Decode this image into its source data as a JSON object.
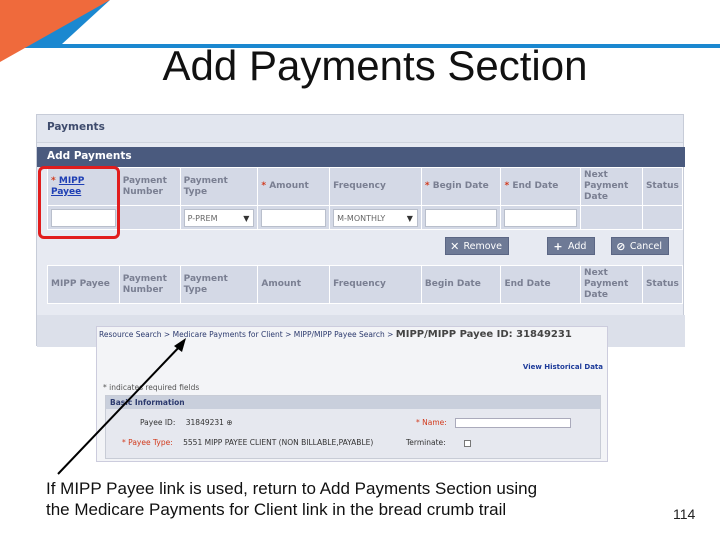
{
  "slide": {
    "title": "Add Payments Section",
    "caption_line1": "If MIPP Payee link is used, return to Add Payments Section  using",
    "caption_line2": "the Medicare Payments for Client link in the bread crumb trail",
    "page_number": "114"
  },
  "panel": {
    "header": "Payments",
    "section_title": "Add Payments",
    "columns": [
      {
        "label": "MIPP Payee",
        "required": true,
        "link": true
      },
      {
        "label": "Payment Number",
        "required": false
      },
      {
        "label": "Payment Type",
        "required": false
      },
      {
        "label": "Amount",
        "required": true
      },
      {
        "label": "Frequency",
        "required": false
      },
      {
        "label": "Begin Date",
        "required": true
      },
      {
        "label": "End Date",
        "required": true
      },
      {
        "label": "Next Payment Date",
        "required": false
      },
      {
        "label": "Status",
        "required": false
      }
    ],
    "payment_type_value": "P-PREM",
    "frequency_value": "M-MONTHLY",
    "required_marker": "*",
    "remove_label": "Remove",
    "add_label": "Add",
    "cancel_label": "Cancel",
    "list_columns": [
      "MIPP Payee",
      "Payment Number",
      "Payment Type",
      "Amount",
      "Frequency",
      "Begin Date",
      "End Date",
      "Next Payment Date",
      "Status"
    ]
  },
  "shot2": {
    "breadcrumb": "Resource Search > Medicare Payments for Client > MIPP/MIPP Payee Search >",
    "payee_id_label": "MIPP/MIPP Payee ID: 31849231",
    "view_history": "View Historical Data",
    "required_note": "* indicates required fields",
    "basic_info": "Basic Information",
    "payee_id_field": "Payee ID:",
    "payee_id_value": "31849231",
    "payee_type_field": "* Payee Type:",
    "payee_type_value": "5551 MIPP PAYEE CLIENT (NON BILLABLE,PAYABLE)",
    "name_field": "* Name:",
    "terminate_field": "Terminate:"
  }
}
